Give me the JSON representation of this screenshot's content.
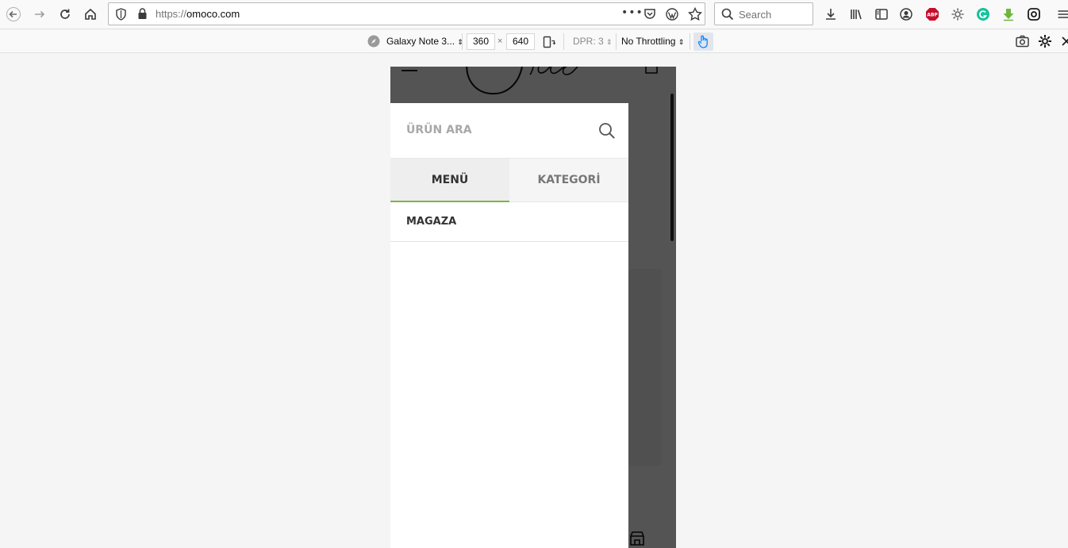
{
  "browser": {
    "url_scheme": "https://",
    "url_host": "omoco.com",
    "search_placeholder": "Search"
  },
  "rdm": {
    "device": "Galaxy Note 3...",
    "width": "360",
    "times": "×",
    "height": "640",
    "dpr": "DPR: 3",
    "throttling": "No Throttling"
  },
  "drawer": {
    "search_placeholder": "ÜRÜN ARA",
    "tabs": [
      {
        "label": "MENÜ",
        "active": true
      },
      {
        "label": "KATEGORİ",
        "active": false
      }
    ],
    "menu_items": [
      {
        "label": "MAGAZA"
      }
    ]
  },
  "colors": {
    "accent": "#81b441",
    "overlay": "#555555"
  }
}
